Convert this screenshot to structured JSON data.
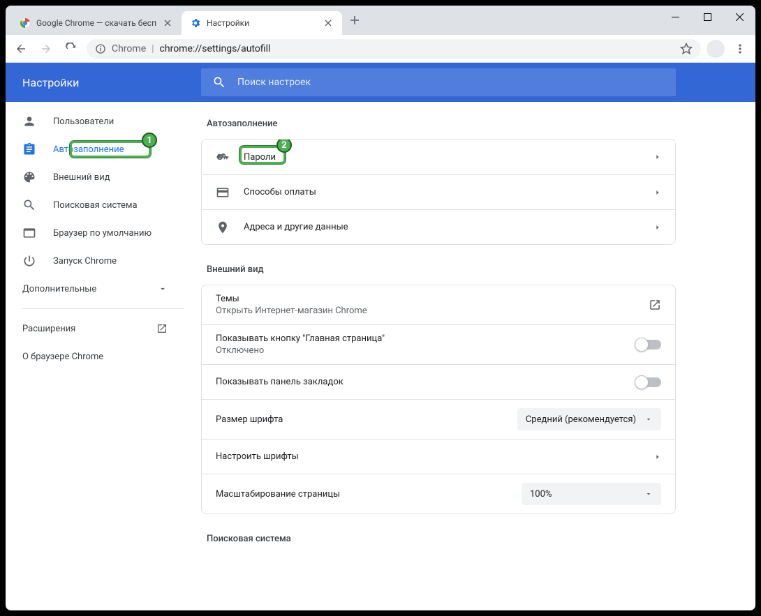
{
  "window": {
    "tabs": [
      {
        "title": "Google Chrome — скачать бесп"
      },
      {
        "title": "Настройки"
      }
    ],
    "url_host": "Chrome",
    "url_path": "chrome://settings/autofill"
  },
  "header": {
    "title": "Настройки",
    "search_placeholder": "Поиск настроек"
  },
  "sidebar": {
    "items": [
      {
        "label": "Пользователи"
      },
      {
        "label": "Автозаполнение"
      },
      {
        "label": "Внешний вид"
      },
      {
        "label": "Поисковая система"
      },
      {
        "label": "Браузер по умолчанию"
      },
      {
        "label": "Запуск Chrome"
      }
    ],
    "advanced": "Дополнительные",
    "extensions": "Расширения",
    "about": "О браузере Chrome"
  },
  "sections": {
    "autofill": {
      "title": "Автозаполнение",
      "rows": [
        {
          "label": "Пароли"
        },
        {
          "label": "Способы оплаты"
        },
        {
          "label": "Адреса и другие данные"
        }
      ]
    },
    "appearance": {
      "title": "Внешний вид",
      "themes": {
        "label": "Темы",
        "sub": "Открыть Интернет-магазин Chrome"
      },
      "home_button": {
        "label": "Показывать кнопку \"Главная страница\"",
        "sub": "Отключено"
      },
      "bookmarks_bar": {
        "label": "Показывать панель закладок"
      },
      "font_size": {
        "label": "Размер шрифта",
        "value": "Средний (рекомендуется)"
      },
      "customize_fonts": {
        "label": "Настроить шрифты"
      },
      "page_zoom": {
        "label": "Масштабирование страницы",
        "value": "100%"
      }
    },
    "search": {
      "title": "Поисковая система"
    }
  },
  "annotations": {
    "one": "1",
    "two": "2"
  }
}
